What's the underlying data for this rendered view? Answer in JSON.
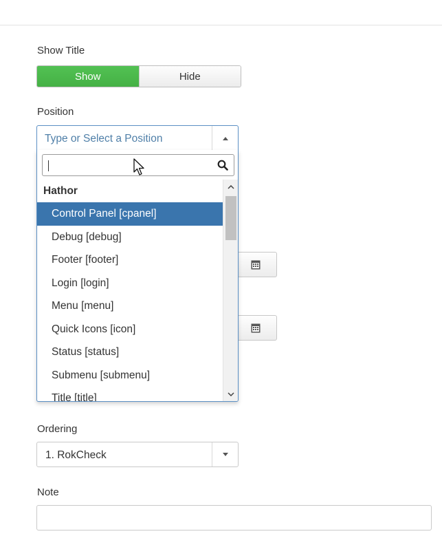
{
  "show_title": {
    "label": "Show Title",
    "options": [
      "Show",
      "Hide"
    ],
    "selected": "Show",
    "active_color": "#4bb74b"
  },
  "position": {
    "label": "Position",
    "placeholder": "Type or Select a Position",
    "search_value": "",
    "group": "Hathor",
    "options": [
      "Control Panel [cpanel]",
      "Debug [debug]",
      "Footer [footer]",
      "Login [login]",
      "Menu [menu]",
      "Quick Icons [icon]",
      "Status [status]",
      "Submenu [submenu]",
      "Title [title]"
    ],
    "highlighted": "Control Panel [cpanel]",
    "highlight_color": "#3a75ad",
    "icons": {
      "search": "magnifier-icon",
      "toggle": "caret-up-icon"
    }
  },
  "calendar_buttons": {
    "icon": "calendar-icon"
  },
  "ordering": {
    "label": "Ordering",
    "value": "1. RokCheck"
  },
  "note": {
    "label": "Note",
    "value": ""
  }
}
